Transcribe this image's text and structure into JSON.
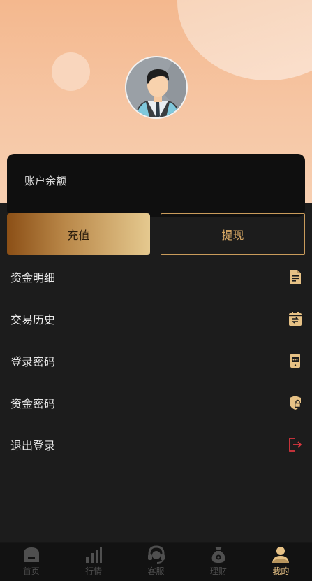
{
  "account": {
    "balance_label": "账户余额"
  },
  "actions": {
    "recharge": "充值",
    "withdraw": "提现"
  },
  "menu": [
    {
      "label": "资金明细",
      "icon": "document-icon"
    },
    {
      "label": "交易历史",
      "icon": "calendar-exchange-icon"
    },
    {
      "label": "登录密码",
      "icon": "phone-password-icon"
    },
    {
      "label": "资金密码",
      "icon": "shield-lock-icon"
    },
    {
      "label": "退出登录",
      "icon": "logout-icon"
    }
  ],
  "tabs": [
    {
      "label": "首页",
      "icon": "home-icon"
    },
    {
      "label": "行情",
      "icon": "bar-chart-icon"
    },
    {
      "label": "客服",
      "icon": "headset-icon"
    },
    {
      "label": "理财",
      "icon": "money-bag-icon"
    },
    {
      "label": "我的",
      "icon": "user-icon",
      "active": true
    }
  ],
  "colors": {
    "gold": "#e6c185",
    "logout_red": "#d9363e",
    "tab_inactive": "#4f4f4f"
  }
}
